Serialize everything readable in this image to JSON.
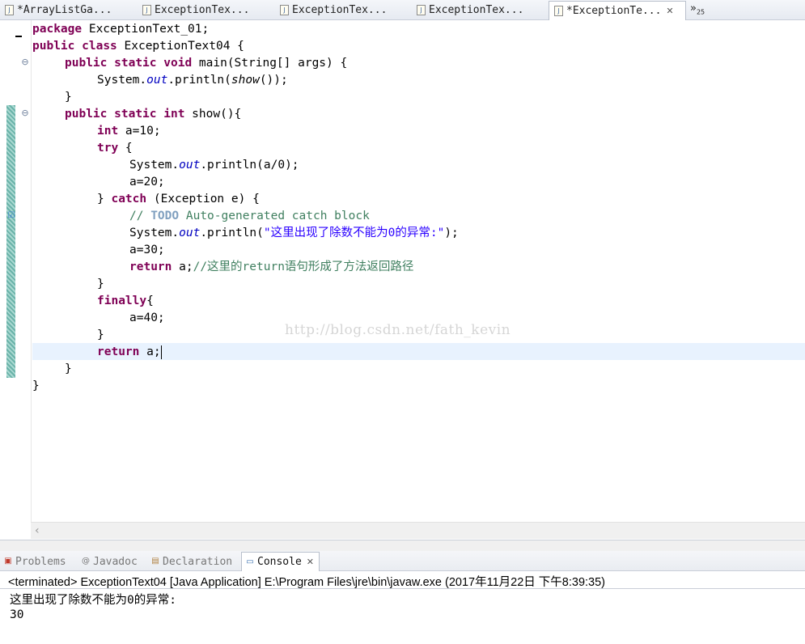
{
  "editor_tabs": [
    {
      "label": "*ArrayListGa...",
      "active": false
    },
    {
      "label": "ExceptionTex...",
      "active": false
    },
    {
      "label": "ExceptionTex...",
      "active": false
    },
    {
      "label": "ExceptionTex...",
      "active": false
    },
    {
      "label": "*ExceptionTe...",
      "active": true
    }
  ],
  "overflow": {
    "label": "»",
    "count": "25"
  },
  "code": {
    "l1": {
      "kw": "package",
      "rest": " ExceptionText_01;"
    },
    "l2": {
      "kw1": "public",
      "kw2": "class",
      "rest": " ExceptionText04 {"
    },
    "l3": {
      "kw1": "public",
      "kw2": "static",
      "kw3": "void",
      "rest": " main(String[] args) {"
    },
    "l4": {
      "a": "System.",
      "field": "out",
      "b": ".println(",
      "meth": "show",
      "c": "());"
    },
    "l5": "}",
    "l6": {
      "kw1": "public",
      "kw2": "static",
      "kw3": "int",
      "rest": " show(){"
    },
    "l7": {
      "kw": "int",
      "rest": " a=10;"
    },
    "l8": {
      "kw": "try",
      "rest": " {"
    },
    "l9": {
      "a": "System.",
      "field": "out",
      "b": ".println(a/0);"
    },
    "l10": "a=20;",
    "l11": {
      "a": "} ",
      "kw": "catch",
      "rest": " (Exception e) {"
    },
    "l12": {
      "c1": "// ",
      "todo": "TODO",
      "c2": " Auto-generated catch block"
    },
    "l13": {
      "a": "System.",
      "field": "out",
      "b": ".println(",
      "str": "\"这里出现了除数不能为0的异常:\"",
      "c": ");"
    },
    "l14": "a=30;",
    "l15": {
      "kw": "return",
      "rest": " a;",
      "cmt": "//这里的return语句形成了方法返回路径"
    },
    "l16": "}",
    "l17": {
      "kw": "finally",
      "rest": "{"
    },
    "l18": "a=40;",
    "l19": "}",
    "l20": {
      "kw": "return",
      "rest": " a;"
    },
    "l21": "}",
    "l22": "}"
  },
  "watermark": "http://blog.csdn.net/fath_kevin",
  "view_tabs": [
    {
      "label": "Problems",
      "icon": "problems-icon",
      "active": false
    },
    {
      "label": "Javadoc",
      "icon": "javadoc-icon",
      "active": false
    },
    {
      "label": "Declaration",
      "icon": "declaration-icon",
      "active": false
    },
    {
      "label": "Console",
      "icon": "console-icon",
      "active": true
    }
  ],
  "console": {
    "header": "<terminated> ExceptionText04 [Java Application] E:\\Program Files\\jre\\bin\\javaw.exe (2017年11月22日 下午8:39:35)",
    "output": [
      "这里出现了除数不能为0的异常:",
      "30"
    ]
  }
}
